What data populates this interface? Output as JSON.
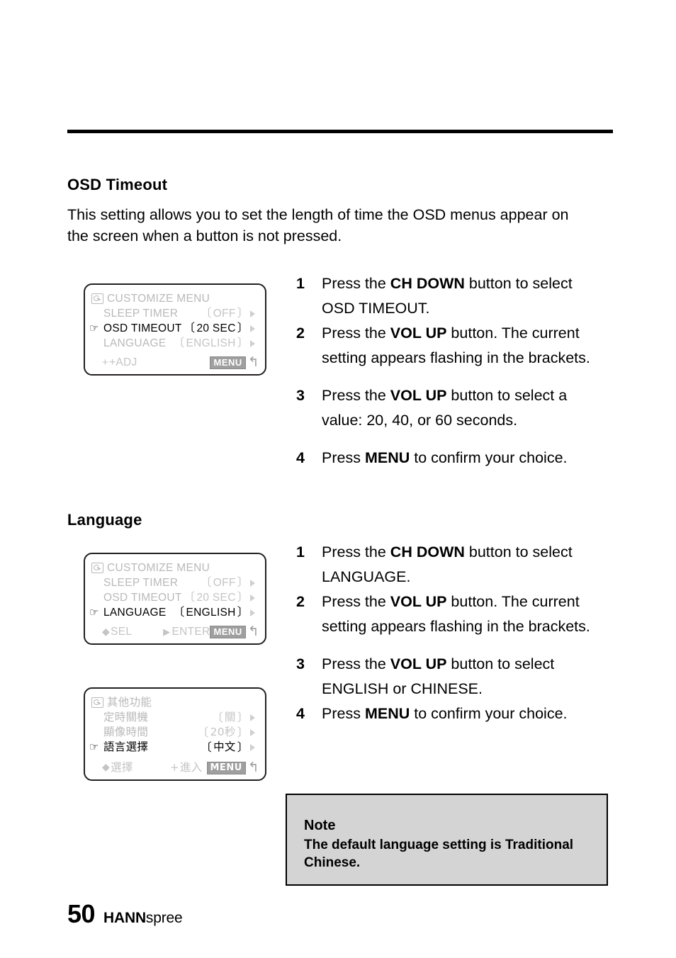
{
  "page": {
    "number": "50",
    "logo_bold": "HANN",
    "logo_light": "spree"
  },
  "sections": {
    "osd_timeout": {
      "heading": "OSD Timeout",
      "intro": "This setting allows you to set the length of time the OSD menus appear on the screen when a button is not pressed.",
      "steps": [
        {
          "num": "1",
          "pre": "Press the ",
          "bold": "CH DOWN",
          "post": " button to select OSD TIMEOUT."
        },
        {
          "num": "2",
          "pre": "Press the ",
          "bold": "VOL UP",
          "post": " button. The current setting appears flashing in the brackets."
        },
        {
          "num": "3",
          "pre": "Press the ",
          "bold": "VOL UP",
          "post": " button to select a value: 20, 40, or 60 seconds."
        },
        {
          "num": "4",
          "pre": "Press ",
          "bold": "MENU",
          "post": " to confirm your choice."
        }
      ]
    },
    "language": {
      "heading": "Language",
      "steps": [
        {
          "num": "1",
          "pre": "Press the ",
          "bold": "CH DOWN",
          "post": " button to select LANGUAGE."
        },
        {
          "num": "2",
          "pre": "Press the ",
          "bold": "VOL UP",
          "post": " button. The current setting appears flashing in the brackets."
        },
        {
          "num": "3",
          "pre": "Press the ",
          "bold": "VOL UP",
          "post": " button to select ENGLISH or CHINESE."
        },
        {
          "num": "4",
          "pre": "Press ",
          "bold": "MENU",
          "post": " to confirm your choice."
        }
      ]
    }
  },
  "osd_screens": [
    {
      "id": "osd-timeout-selected",
      "title": "CUSTOMIZE  MENU",
      "rows": [
        {
          "label": "SLEEP TIMER",
          "value": "OFF",
          "selected": false
        },
        {
          "label": "OSD TIMEOUT",
          "value": "20  SEC",
          "selected": true
        },
        {
          "label": "LANGUAGE",
          "value": "ENGLISH",
          "selected": false
        }
      ],
      "footer": {
        "left": "+ADJ",
        "middle": "",
        "menu": "MENU"
      }
    },
    {
      "id": "language-selected",
      "title": "CUSTOMIZE  MENU",
      "rows": [
        {
          "label": "SLEEP TIMER",
          "value": "OFF",
          "selected": false
        },
        {
          "label": "OSD TIMEOUT",
          "value": "20  SEC",
          "selected": false
        },
        {
          "label": "LANGUAGE",
          "value": "ENGLISH",
          "selected": true
        }
      ],
      "footer": {
        "left": "SEL",
        "middle": "ENTER",
        "menu": "MENU"
      }
    },
    {
      "id": "language-chinese",
      "title": "其他功能",
      "rows": [
        {
          "label": "定時關機",
          "value": "關",
          "selected": false
        },
        {
          "label": "顯像時間",
          "value": "20秒",
          "selected": false
        },
        {
          "label": "語言選擇",
          "value": "中文",
          "selected": true
        }
      ],
      "footer": {
        "left": "選擇",
        "middle": "進入",
        "menu": "MENU"
      }
    }
  ],
  "note": {
    "title": "Note",
    "body": "The default language setting is Traditional Chinese."
  },
  "glyphs": {
    "pointer": "☞",
    "bracket_open": "〔",
    "bracket_close": "〕",
    "updown": "◆",
    "play": "▶",
    "plus": "+",
    "return": "↰"
  },
  "colors": {
    "note_bg": "#d4d4d4",
    "osd_dim": "#b9b9b9",
    "menu_chip": "#9f9f9f",
    "rule": "#000000"
  }
}
